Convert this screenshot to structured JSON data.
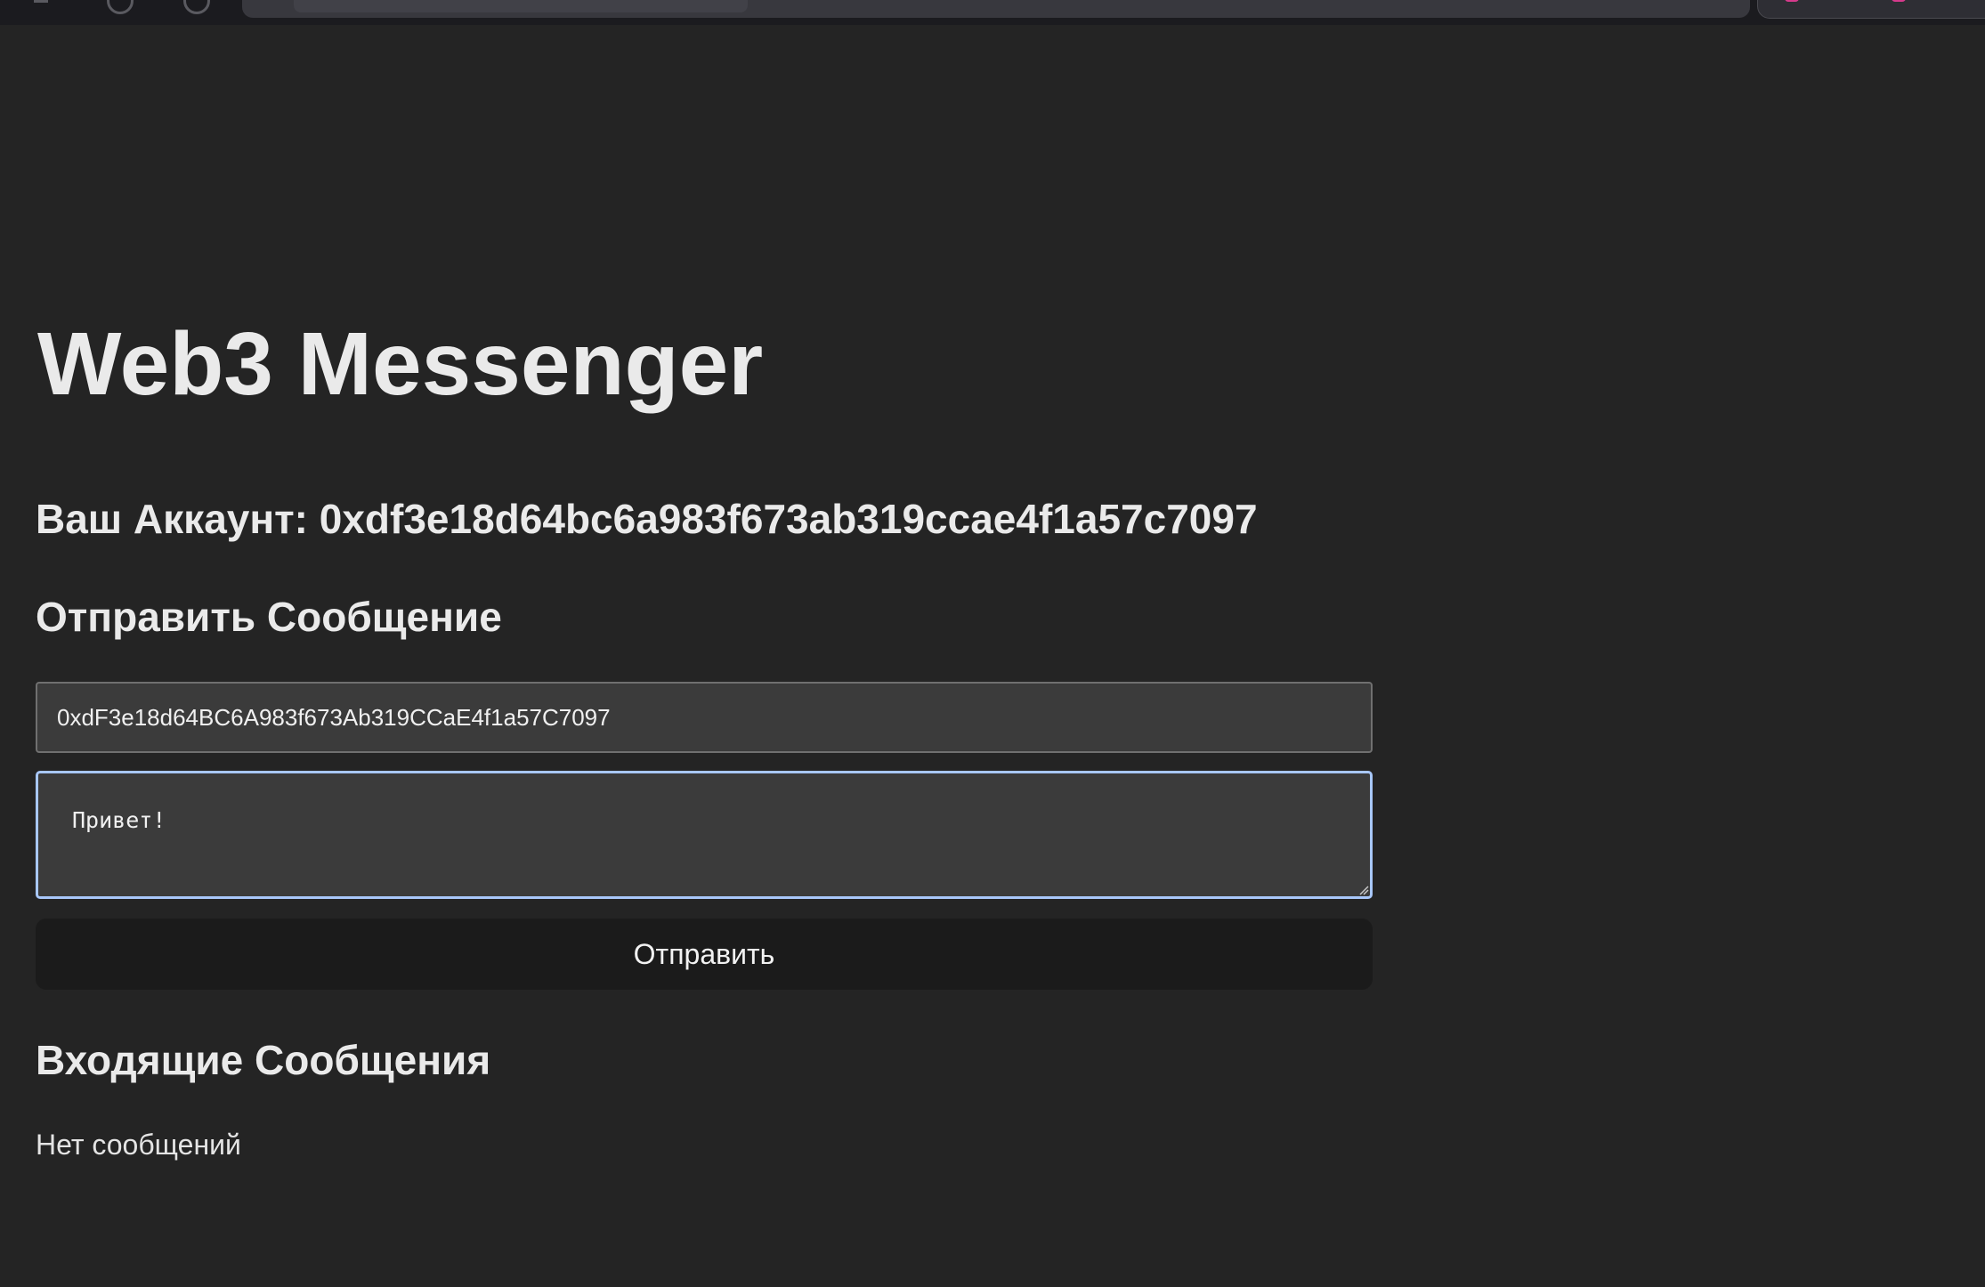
{
  "app": {
    "title": "Web3 Messenger",
    "account_line": "Ваш Аккаунт: 0xdf3e18d64bc6a983f673ab319ccae4f1a57c7097"
  },
  "send": {
    "heading": "Отправить Сообщение",
    "recipient_value": "0xdF3e18d64BC6A983f673Ab319CCaE4f1a57C7097",
    "message_value": "Привет!",
    "button_label": "Отправить"
  },
  "inbox": {
    "heading": "Входящие Сообщения",
    "empty_text": "Нет сообщений"
  },
  "colors": {
    "background": "#242424",
    "input_bg": "#3b3b3b",
    "focus_ring": "#a8c7fa",
    "button_bg": "#1b1b1b",
    "text": "#eaeaea"
  }
}
